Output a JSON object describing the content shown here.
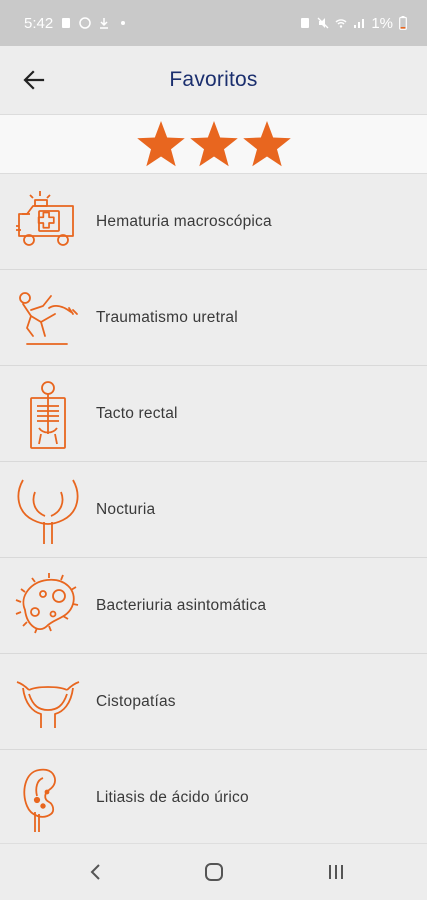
{
  "status_bar": {
    "time": "5:42",
    "battery": "1%"
  },
  "header": {
    "title": "Favoritos"
  },
  "rating": {
    "stars": 3,
    "star_color": "#e8661f"
  },
  "items": [
    {
      "label": "Hematuria macroscópica",
      "icon": "ambulance-icon"
    },
    {
      "label": "Traumatismo uretral",
      "icon": "falling-person-icon"
    },
    {
      "label": "Tacto rectal",
      "icon": "xray-skeleton-icon"
    },
    {
      "label": "Nocturia",
      "icon": "prostate-icon"
    },
    {
      "label": "Bacteriuria asintomática",
      "icon": "bacteria-icon"
    },
    {
      "label": "Cistopatías",
      "icon": "bladder-icon"
    },
    {
      "label": "Litiasis de ácido úrico",
      "icon": "kidney-stone-icon"
    }
  ],
  "colors": {
    "accent": "#e8661f",
    "title": "#1b2f6e"
  }
}
